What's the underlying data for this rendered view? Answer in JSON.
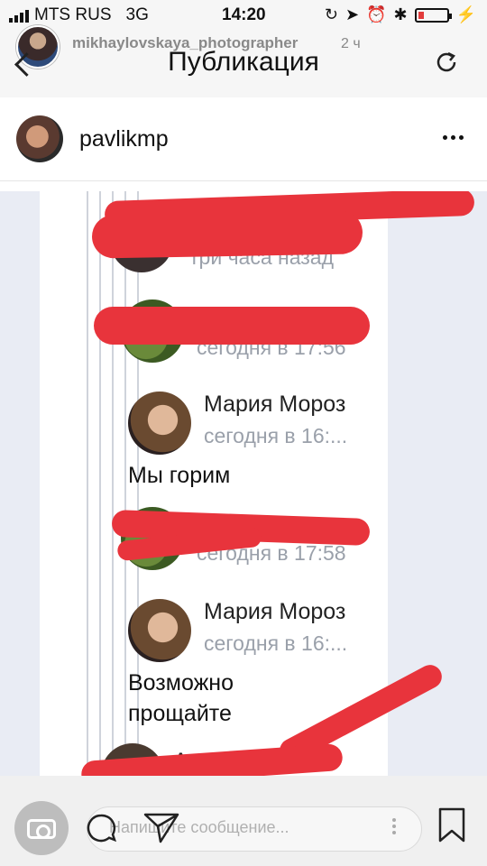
{
  "status_bar": {
    "carrier": "MTS RUS",
    "network": "3G",
    "time": "14:20",
    "battery_level": 0.2,
    "icons": [
      "signal-icon",
      "lock-rotation-icon",
      "location-icon",
      "alarm-icon",
      "bluetooth-icon",
      "battery-icon",
      "charging-icon"
    ]
  },
  "header": {
    "story_user": "mikhaylovskaya_photographer",
    "story_time": "2 ч",
    "title": "Публикация",
    "icons": [
      "back-icon",
      "refresh-icon"
    ]
  },
  "post": {
    "username": "pavlikmp",
    "icons": [
      "more-icon"
    ]
  },
  "screenshot": {
    "messages": [
      {
        "when": "три часа назад"
      },
      {
        "when": "сегодня в 17:56"
      },
      {
        "name": "Мария Мороз",
        "when": "сегодня в 16:...",
        "text": "Мы горим"
      },
      {
        "when": "сегодня в 17:58"
      },
      {
        "name": "Мария Мороз",
        "when": "сегодня в 16:...",
        "text_line1": "Возможно",
        "text_line2": "прощайте"
      },
      {
        "name": "Ал"
      }
    ],
    "colors": {
      "scribble": "#e8343c",
      "background": "#e9ecf4"
    }
  },
  "bottom_bar": {
    "placeholder": "Напишите сообщение...",
    "icons": [
      "camera-icon",
      "comment-icon",
      "send-icon",
      "bookmark-icon"
    ]
  }
}
